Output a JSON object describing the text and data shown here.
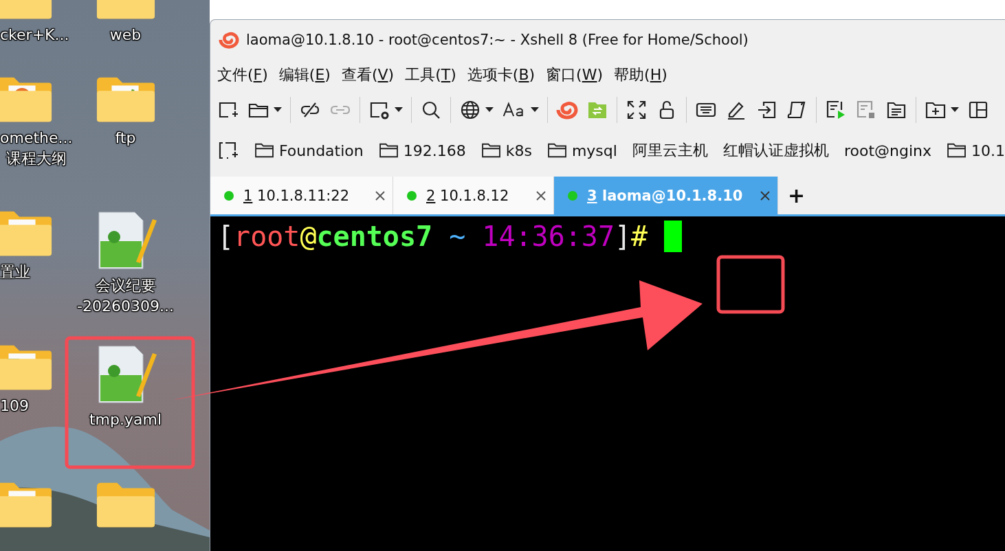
{
  "desktop": {
    "icons": [
      {
        "label": "cker+K...",
        "kind": "folder-plain"
      },
      {
        "label": "web",
        "kind": "folder-plain"
      },
      {
        "label": "omethe...",
        "label_2": "课程大纲",
        "kind": "folder-slides"
      },
      {
        "label": "ftp",
        "kind": "folder-notepad"
      },
      {
        "label": "置业",
        "kind": "folder-document"
      },
      {
        "label": "会议纪要",
        "label_2": "-20260309...",
        "kind": "notepad-file"
      },
      {
        "label": "109",
        "kind": "folder-spreadsheet"
      },
      {
        "label": "tmp.yaml",
        "kind": "notepad-file"
      },
      {
        "kind": "folder-document"
      },
      {
        "kind": "folder-plain"
      }
    ]
  },
  "window": {
    "title": "laoma@10.1.8.10 - root@centos7:~ - Xshell 8 (Free for Home/School)",
    "menu": [
      {
        "before": "文件(",
        "key": "F",
        "after": ")"
      },
      {
        "before": "编辑(",
        "key": "E",
        "after": ")"
      },
      {
        "before": "查看(",
        "key": "V",
        "after": ")"
      },
      {
        "before": "工具(",
        "key": "T",
        "after": ")"
      },
      {
        "before": "选项卡(",
        "key": "B",
        "after": ")"
      },
      {
        "before": "窗口(",
        "key": "W",
        "after": ")"
      },
      {
        "before": "帮助(",
        "key": "H",
        "after": ")"
      }
    ],
    "bookmarks": [
      {
        "kind": "folder",
        "label": "Foundation"
      },
      {
        "kind": "folder",
        "label": "192.168"
      },
      {
        "kind": "folder",
        "label": "k8s"
      },
      {
        "kind": "folder",
        "label": "mysql"
      },
      {
        "kind": "session",
        "label": "阿里云主机"
      },
      {
        "kind": "session",
        "label": "红帽认证虚拟机"
      },
      {
        "kind": "session",
        "label": "root@nginx"
      },
      {
        "kind": "folder",
        "label": "10.1"
      }
    ],
    "tabs": [
      {
        "number": "1",
        "label": "10.1.8.11:22",
        "selected": false,
        "color": "#1ec81e"
      },
      {
        "number": "2",
        "label": "10.1.8.12",
        "selected": false,
        "color": "#1ec81e"
      },
      {
        "number": "3",
        "label": "laoma@10.1.8.10",
        "selected": true,
        "color": "#1ec81e"
      }
    ],
    "new_tab": "+",
    "terminal": {
      "prompt": [
        {
          "text": "[",
          "color": "#e8e8e8"
        },
        {
          "text": "root",
          "color": "#ff5555"
        },
        {
          "text": "@",
          "color": "#ffff55"
        },
        {
          "text": "centos7",
          "color": "#55ff55",
          "bold": true
        },
        {
          "text": " ~ ",
          "color": "#4fb4ff"
        },
        {
          "text": "14:36:37",
          "color": "#c000c0"
        },
        {
          "text": "]",
          "color": "#e8e8e8"
        },
        {
          "text": "#",
          "color": "#ffff55"
        }
      ]
    }
  }
}
